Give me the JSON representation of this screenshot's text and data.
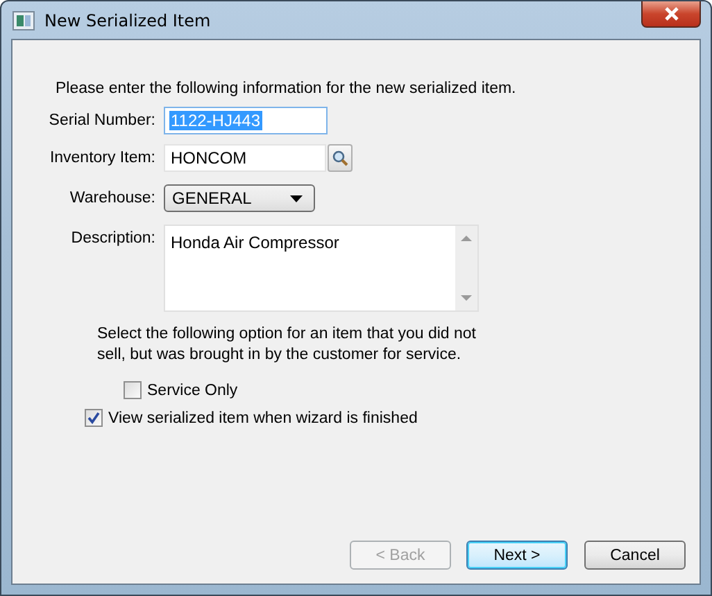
{
  "window": {
    "title": "New Serialized Item"
  },
  "intro": "Please enter the following information for the new serialized item.",
  "fields": [
    {
      "kind": "text",
      "label": "Serial Number:",
      "value": "1122-HJ443",
      "selected": true
    },
    {
      "kind": "lookup",
      "label": "Inventory Item:",
      "value": "HONCOM",
      "selected": false
    },
    {
      "kind": "dropdown",
      "label": "Warehouse:",
      "value": "GENERAL",
      "selected": false
    },
    {
      "kind": "memo",
      "label": "Description:",
      "value": "Honda Air Compressor",
      "selected": false
    }
  ],
  "note": "Select the following option for an item that you did not sell, but was brought in by the customer for service.",
  "options": [
    {
      "label": "Service Only",
      "checked": false,
      "indented": true
    },
    {
      "label": "View serialized item when wizard is finished",
      "checked": true,
      "indented": false
    }
  ],
  "buttons": [
    {
      "label": "< Back",
      "disabled": true,
      "default": false
    },
    {
      "label": "Next >",
      "disabled": false,
      "default": true
    },
    {
      "label": "Cancel",
      "disabled": false,
      "default": false
    }
  ]
}
